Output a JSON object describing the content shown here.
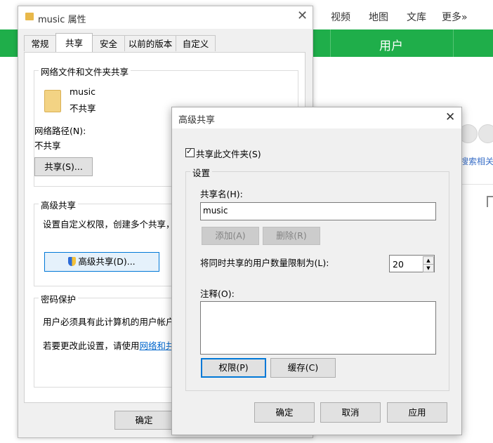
{
  "browser": {
    "nav": [
      "视频",
      "地图",
      "文库",
      "更多»"
    ],
    "green_tab": "用户",
    "side_link": "搜索相关文",
    "accent": "#1fae4a"
  },
  "properties": {
    "title": "music 属性",
    "tabs": [
      "常规",
      "共享",
      "安全",
      "以前的版本",
      "自定义"
    ],
    "active_tab": "共享",
    "network_group": "网络文件和文件夹共享",
    "folder_name": "music",
    "folder_status": "不共享",
    "path_label": "网络路径(N):",
    "path_value": "不共享",
    "share_button": "共享(S)...",
    "advanced_group": "高级共享",
    "advanced_desc": "设置自定义权限，创建多个共享，并",
    "advanced_button": "高级共享(D)...",
    "password_group": "密码保护",
    "password_desc": "用户必须具有此计算机的用户帐户和",
    "password_change": "若要更改此设置，请使用",
    "password_link": "网络和共享",
    "ok_button": "确定"
  },
  "advanced": {
    "title": "高级共享",
    "share_checkbox_label": "共享此文件夹(S)",
    "share_checked": true,
    "settings_group": "设置",
    "share_name_label": "共享名(H):",
    "share_name_value": "music",
    "add_button": "添加(A)",
    "remove_button": "删除(R)",
    "limit_label": "将同时共享的用户数量限制为(L):",
    "limit_value": "20",
    "comment_label": "注释(O):",
    "comment_value": "",
    "permissions_button": "权限(P)",
    "caching_button": "缓存(C)",
    "ok_button": "确定",
    "cancel_button": "取消",
    "apply_button": "应用"
  }
}
